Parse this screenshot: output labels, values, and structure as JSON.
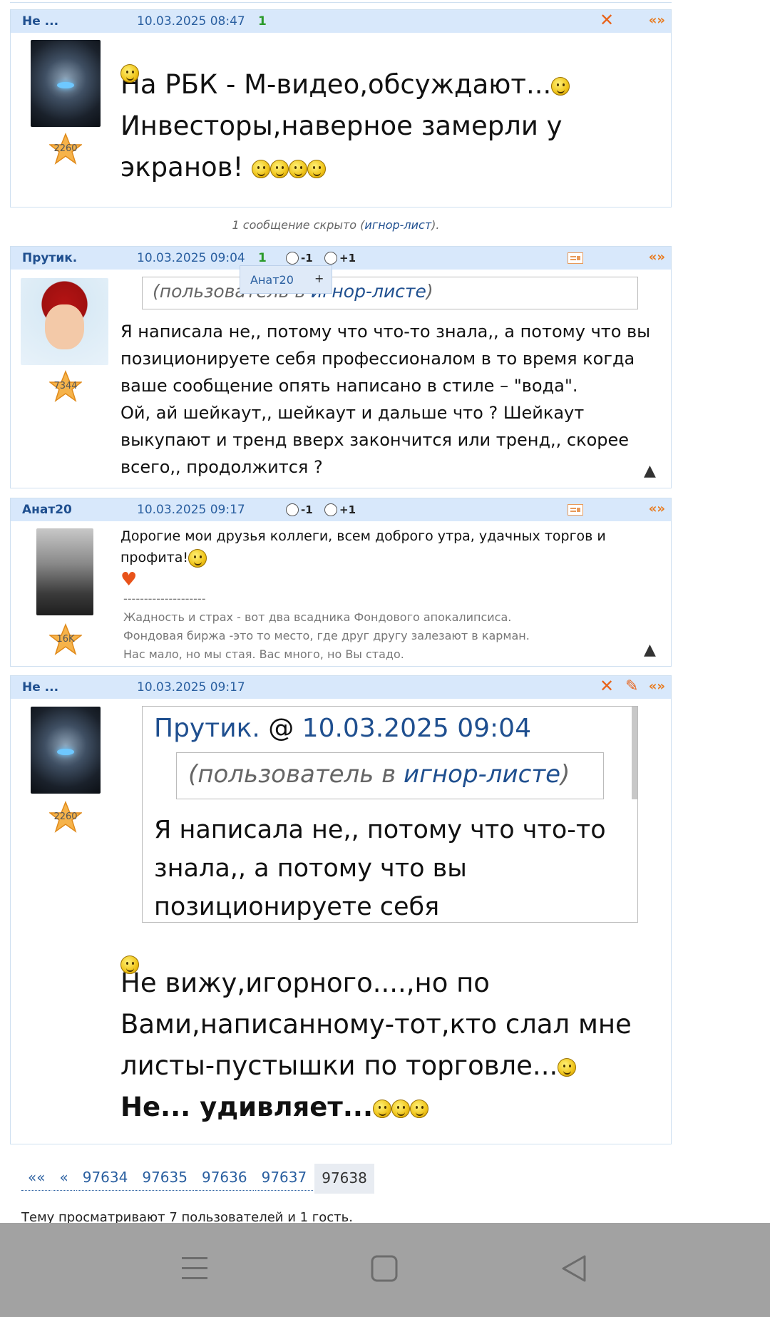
{
  "posts": [
    {
      "author": "Не ...",
      "date": "10.03.2025 08:47",
      "rating": "1",
      "rank": "2260",
      "text_lines": [
        "На РБК - М-видео,обсуждают...",
        "Инвесторы,наверное замерли у",
        "экранов!"
      ],
      "quote_label": "«»"
    },
    {
      "author": "Прутик.",
      "date": "10.03.2025 09:04",
      "rating": "1",
      "minus": "-1",
      "plus": "+1",
      "rank": "7344",
      "ignore_prefix": "(пользователь в ",
      "ignore_link": "игнор-листе",
      "ignore_suffix": ")",
      "text_lines": [
        "Я написала не,, потому что что-то знала,, а потому что вы",
        "позиционируете себя профессионалом в то время когда",
        "ваше сообщение опять написано в стиле – \"вода\".",
        "Ой, ай шейкаут,, шейкаут и дальше что ? Шейкаут",
        "выкупают и тренд вверх закончится или тренд,, скорее",
        "всего,, продолжится ?"
      ],
      "quote_label": "«»"
    },
    {
      "author": "Анат20",
      "date": "10.03.2025 09:17",
      "minus": "-1",
      "plus": "+1",
      "rank": "16K",
      "text": "Дорогие мои друзья коллеги, всем доброго утра, удачных торгов и профита!",
      "sig_divider": "--------------------",
      "sig_lines": [
        "Жадность и страх - вот два всадника Фондового апокалипсиса.",
        "Фондовая биржа -это то место, где друг другу залезают в карман.",
        "Нас мало, но мы стая. Вас много, но Вы стадо."
      ],
      "quote_label": "«»"
    },
    {
      "author": "Не ...",
      "date": "10.03.2025 09:17",
      "rank": "2260",
      "quote_author": "Прутик.",
      "quote_at": " @ ",
      "quote_date": "10.03.2025 09:04",
      "ignore_prefix": "(пользователь в ",
      "ignore_link": "игнор-листе",
      "ignore_suffix": ")",
      "quote_lines": [
        "Я написала не,, потому что что-то",
        "знала,, а потому что вы",
        "позиционируете себя"
      ],
      "text_lines": [
        "Не вижу,игорного....,но по",
        "Вами,написанному-тот,кто слал мне",
        "листы-пустышки по торговле..."
      ],
      "bold_line": "Не... удивляет...",
      "quote_label": "«»"
    }
  ],
  "hidden_notice": {
    "prefix": "1 сообщение скрыто (",
    "link": "игнор-лист",
    "suffix": ")."
  },
  "popup": {
    "name": "Анат20",
    "plus": "+"
  },
  "pager": {
    "first": "««",
    "prev": "«",
    "pages": [
      "97634",
      "97635",
      "97636",
      "97637"
    ],
    "current": "97638"
  },
  "viewers": "Тему просматривают 7 пользователей и 1 гость.",
  "colors": {
    "header_bg": "#d8e8fb",
    "link": "#1f4f8f",
    "accent": "#e87a1e",
    "navbar": "#a2a2a2"
  }
}
